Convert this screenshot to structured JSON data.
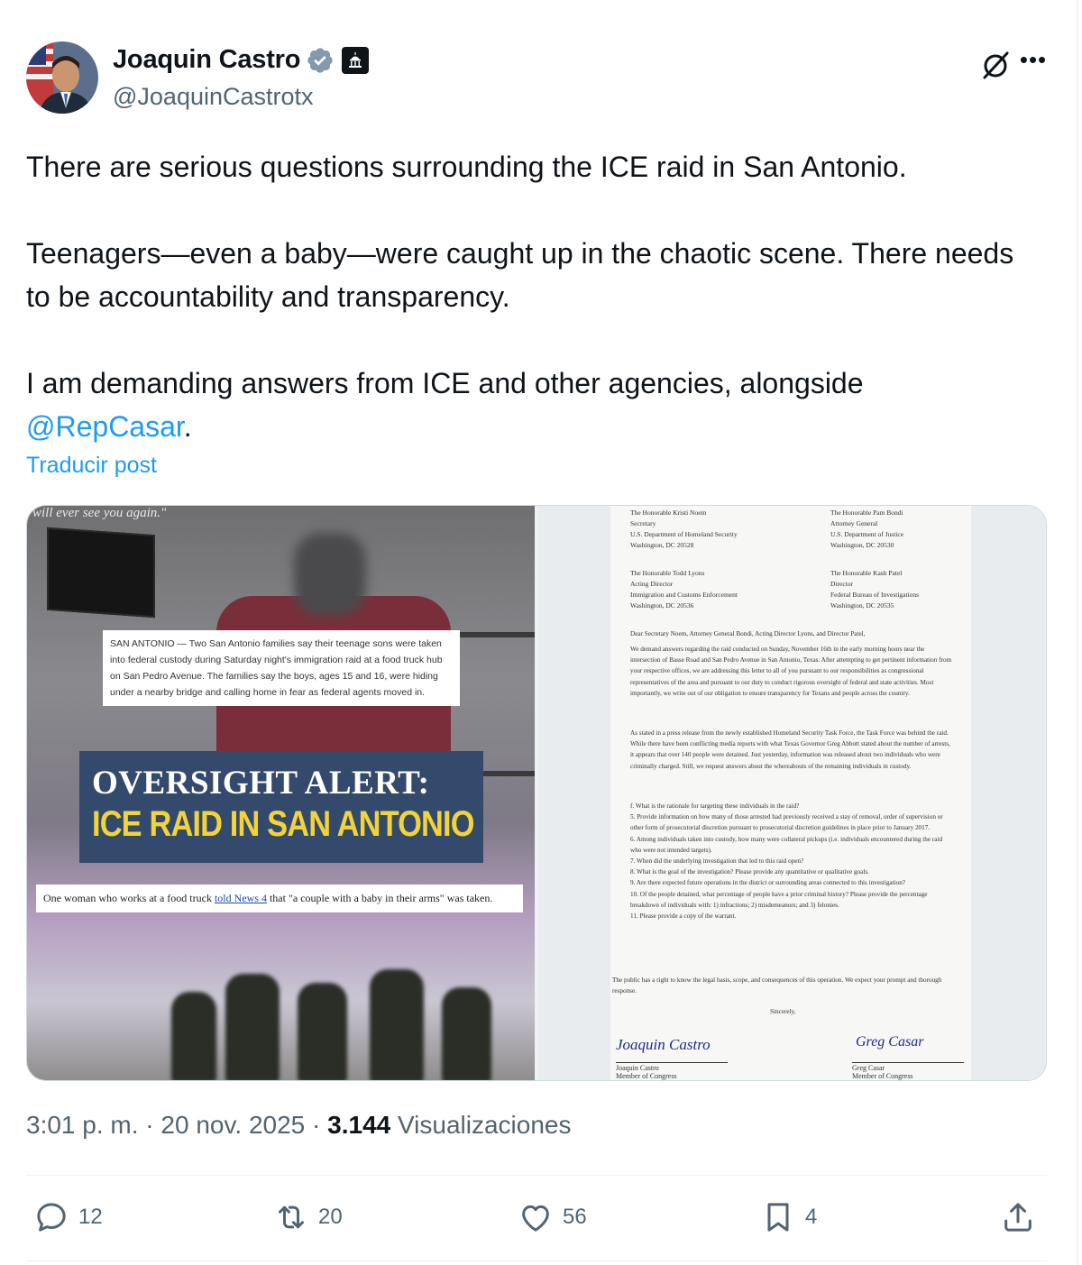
{
  "author": {
    "name": "Joaquin Castro",
    "handle": "@JoaquinCastrotx"
  },
  "tweet": {
    "line1": "There are serious questions surrounding the ICE raid in San Antonio.",
    "line2": "Teenagers—even a baby—were caught up in the chaotic scene. There needs to be accountability and transparency.",
    "line3_prefix": "I am demanding answers from ICE and other agencies, alongside ",
    "mention": "@RepCasar",
    "line3_suffix": ".",
    "translate": "Traducir post"
  },
  "media_left": {
    "quote": "will ever see you again.\"",
    "news_note": "SAN ANTONIO — Two San Antonio families say their teenage sons were taken into federal custody during Saturday night's immigration raid at a food truck hub on San Pedro Avenue. The families say the boys, ages 15 and 16, were hiding under a nearby bridge and calling home in fear as federal agents moved in.",
    "alert_line1": "OVERSIGHT ALERT:",
    "alert_line2": "ICE RAID IN SAN ANTONIO",
    "woman_note_prefix": "One woman who works at a food truck ",
    "woman_note_link": "told News 4",
    "woman_note_suffix": " that \"a couple with a baby in their arms\" was taken."
  },
  "media_right": {
    "addr1": [
      "The Honorable Kristi Noem",
      "Secretary",
      "U.S. Department of Homeland Security",
      "Washington, DC 20528"
    ],
    "addr2": [
      "The Honorable Pam Bondi",
      "Attorney General",
      "U.S. Department of Justice",
      "Washington, DC 20530"
    ],
    "addr3": [
      "The Honorable Todd Lyons",
      "Acting Director",
      "Immigration and Customs Enforcement",
      "Washington, DC 20536"
    ],
    "addr4": [
      "The Honorable Kash Patel",
      "Director",
      "Federal Bureau of Investigations",
      "Washington, DC 20535"
    ],
    "salutation": "Dear Secretary Noem, Attorney General Bondi, Acting Director Lyons, and Director Patel,",
    "para1": "We demand answers regarding the raid conducted on Sunday, November 16th in the early morning hours near the intersection of Basse Road and San Pedro Avenue in San Antonio, Texas. After attempting to get pertinent information from your respective offices, we are addressing this letter to all of you pursuant to our responsibilities as congressional representatives of the area and pursuant to our duty to conduct rigorous oversight of federal and state activities. Most importantly, we write out of our obligation to ensure transparency for Texans and people across the country.",
    "para2": "As stated in a press release from the newly established Homeland Security Task Force, the Task Force was behind the raid. While there have been conflicting media reports with what Texas Governor Greg Abbott stated about the number of arrests, it appears that over 140 people were detained. Just yesterday, information was released about two individuals who were criminally charged. Still, we request answers about the whereabouts of the remaining individuals in custody.",
    "items": [
      "f.   What is the rationale for targeting these individuals in the raid?",
      "5.  Provide information on how many of those arrested had previously received a stay of removal, order of supervision or other form of prosecutorial discretion pursuant to prosecutorial discretion guidelines in place prior to January 2017.",
      "6.  Among individuals taken into custody, how many were collateral pickups (i.e. individuals encountered during the raid who were not intended targets).",
      "7.  When did the underlying investigation that led to this raid open?",
      "8.  What is the goal of the investigation? Please provide any quantitative or qualitative goals.",
      "9.  Are there expected future operations in the district or surrounding areas connected to this investigation?",
      "10. Of the people detained, what percentage of people have a prior criminal history? Please provide the percentage breakdown of individuals with: 1) infractions; 2) misdemeanors; and 3) felonies.",
      "11. Please provide a copy of the warrant."
    ],
    "closing": "The public has a right to know the legal basis, scope, and consequences of this operation. We expect your prompt and thorough response.",
    "sincerely": "Sincerely,",
    "sig1_script": "Joaquin Castro",
    "sig1_name": "Joaquin Castro",
    "sig1_title": "Member of Congress",
    "sig2_script": "Greg Casar",
    "sig2_name": "Greg Casar",
    "sig2_title": "Member of Congress"
  },
  "meta": {
    "time": "3:01 p. m.",
    "sep1": " · ",
    "date": "20 nov. 2025",
    "sep2": " · ",
    "views": "3.144",
    "views_label": " Visualizaciones"
  },
  "actions": {
    "replies": "12",
    "reposts": "20",
    "likes": "56",
    "bookmarks": "4"
  },
  "colors": {
    "accent": "#1d9bf0",
    "text": "#0f1419",
    "muted": "#536471",
    "alert_bg": "#334a6d",
    "alert_yellow": "#f3d33a"
  }
}
